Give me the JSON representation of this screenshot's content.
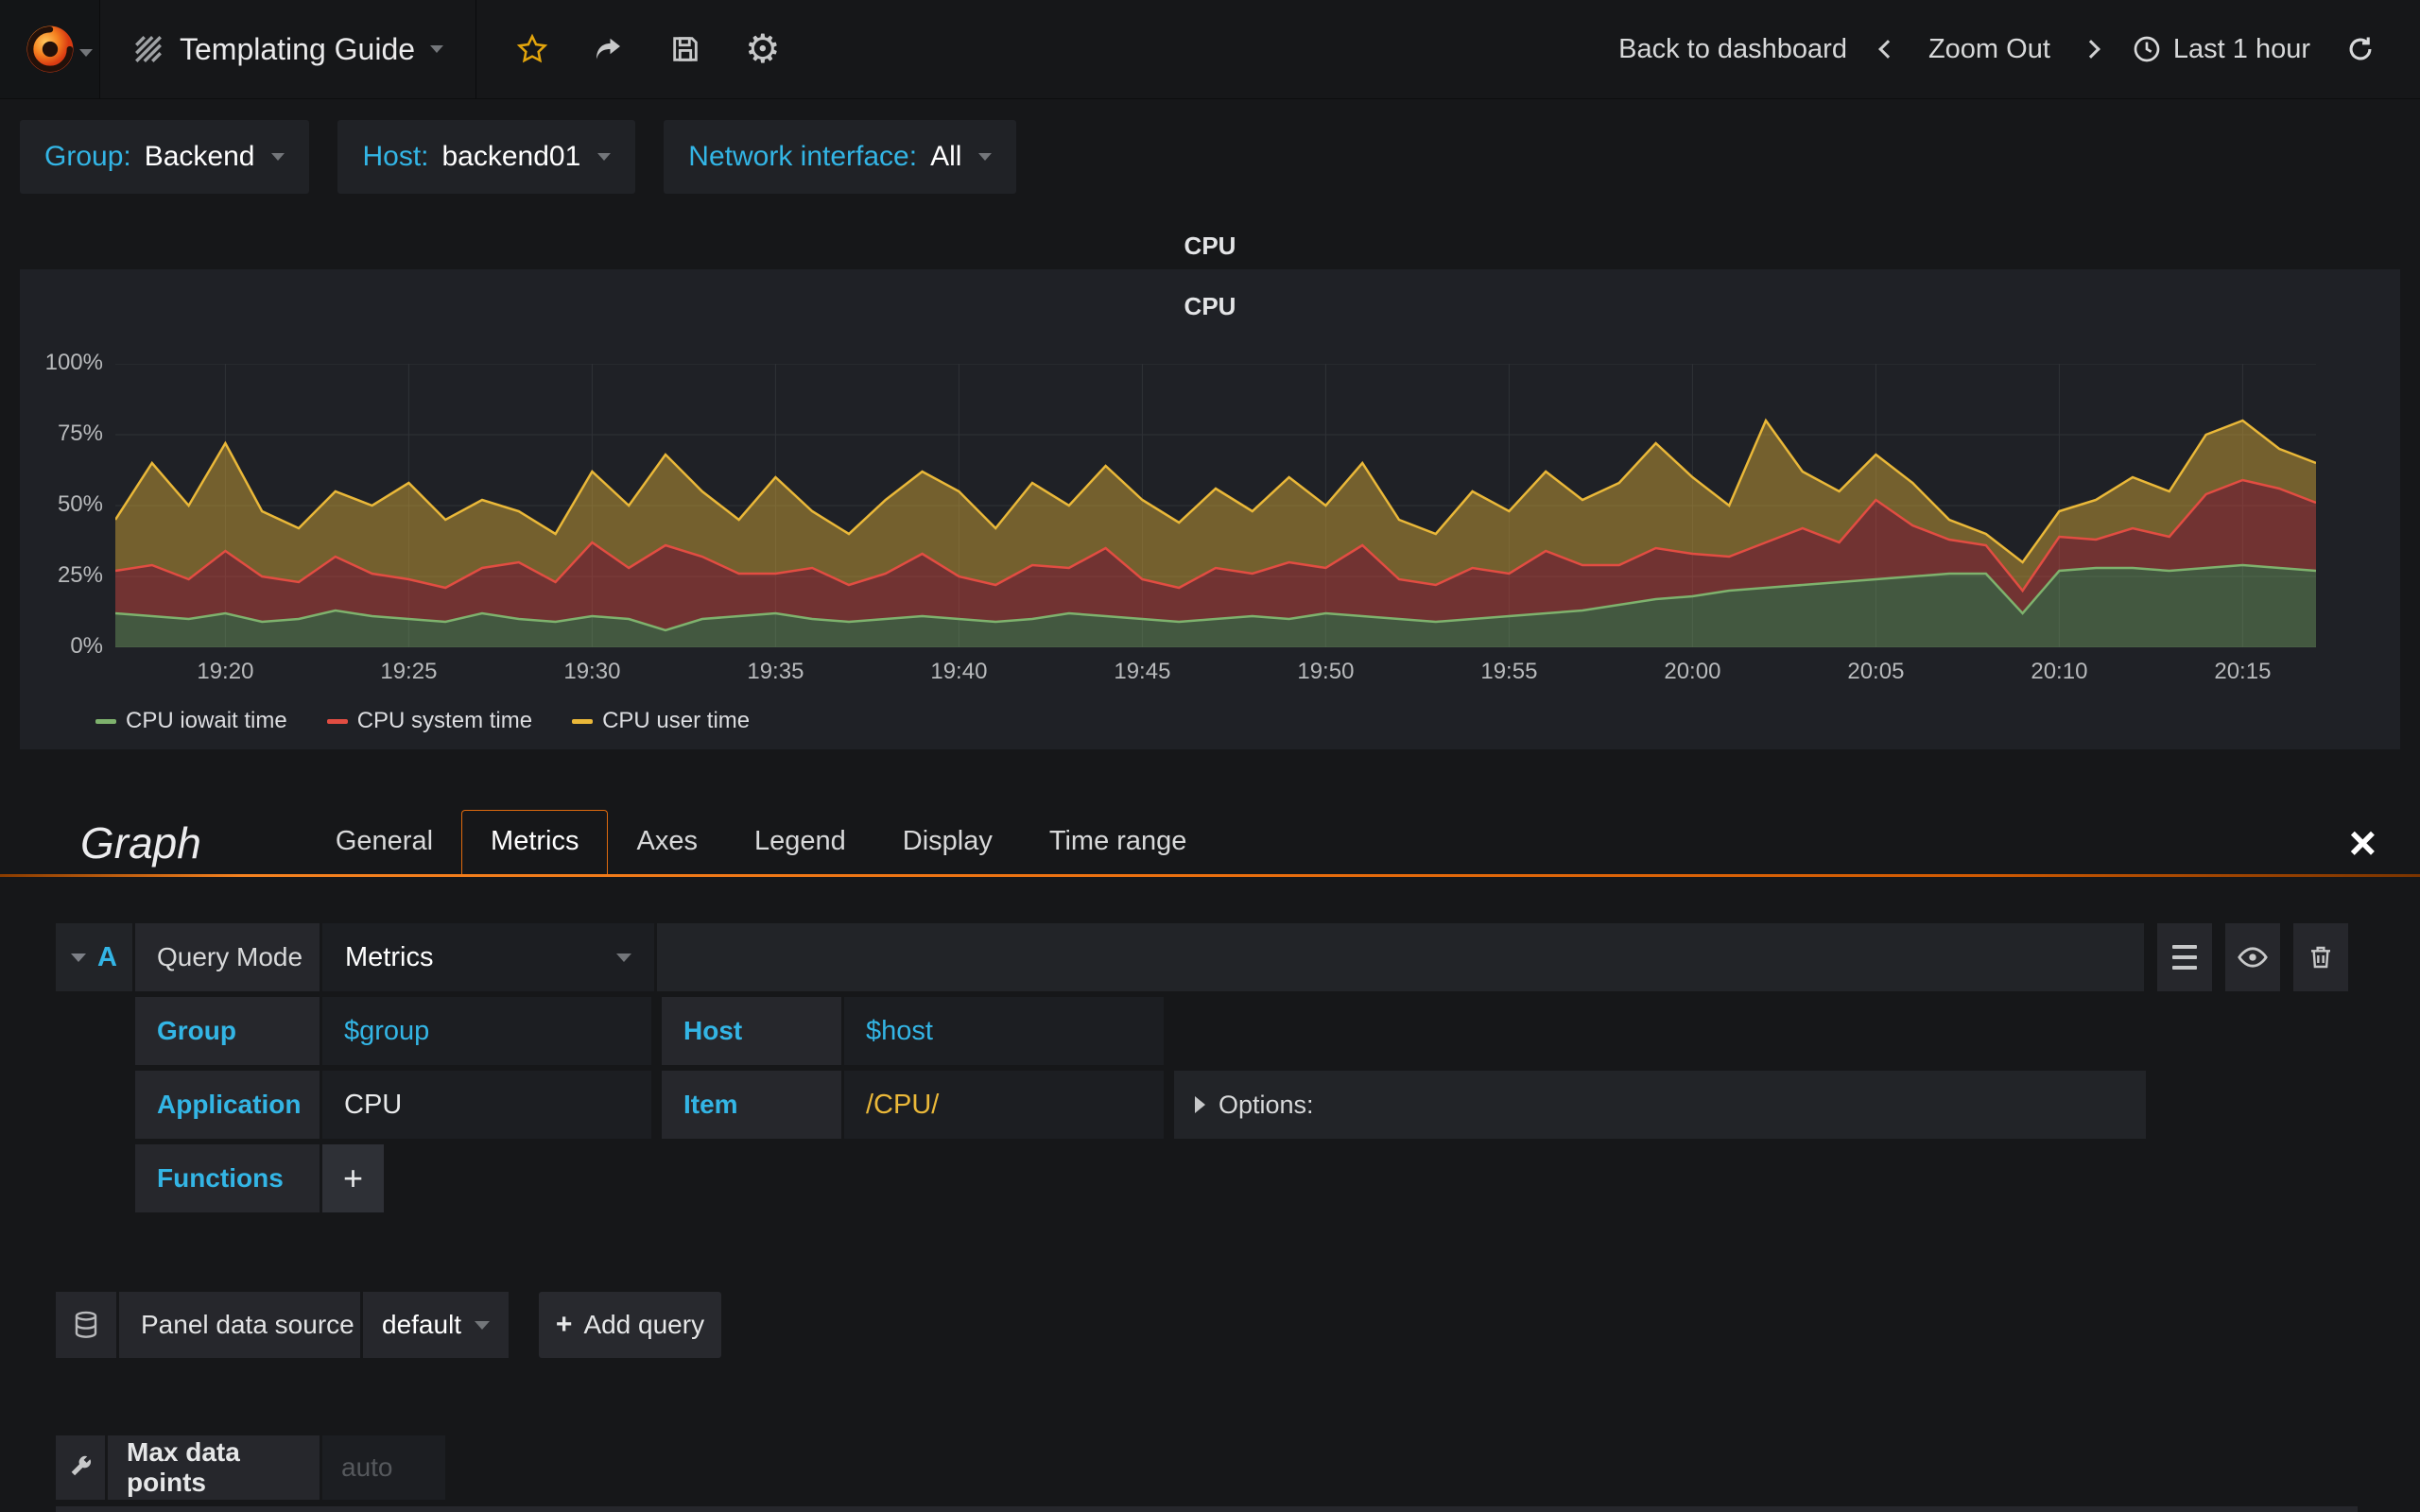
{
  "navbar": {
    "title": "Templating Guide",
    "back_to_dashboard": "Back to dashboard",
    "zoom_out": "Zoom Out",
    "time_range": "Last 1 hour"
  },
  "variables": [
    {
      "label": "Group:",
      "value": "Backend"
    },
    {
      "label": "Host:",
      "value": "backend01"
    },
    {
      "label": "Network interface:",
      "value": "All"
    }
  ],
  "panel": {
    "title": "CPU"
  },
  "chart_data": {
    "type": "area",
    "stacked": true,
    "title": "CPU",
    "ylim": [
      0,
      100
    ],
    "y_ticks": [
      "0%",
      "25%",
      "50%",
      "75%",
      "100%"
    ],
    "x_start": "19:17",
    "x_end": "20:17",
    "x_interval_minutes": 1,
    "x_tick_labels": [
      "19:20",
      "19:25",
      "19:30",
      "19:35",
      "19:40",
      "19:45",
      "19:50",
      "19:55",
      "20:00",
      "20:05",
      "20:10",
      "20:15"
    ],
    "x_first_tick_index": 3,
    "x_tick_step": 5,
    "grid": true,
    "legend_position": "bottom",
    "unit": "percent",
    "series": [
      {
        "name": "CPU iowait time",
        "color": "#7EB26D",
        "values": [
          12,
          11,
          10,
          12,
          9,
          10,
          13,
          11,
          10,
          9,
          12,
          10,
          9,
          11,
          10,
          6,
          10,
          11,
          12,
          10,
          9,
          10,
          11,
          10,
          9,
          10,
          12,
          11,
          10,
          9,
          10,
          11,
          10,
          12,
          11,
          10,
          9,
          10,
          11,
          12,
          13,
          15,
          17,
          18,
          20,
          21,
          22,
          23,
          24,
          25,
          26,
          26,
          12,
          27,
          28,
          28,
          27,
          28,
          29,
          28,
          27
        ]
      },
      {
        "name": "CPU system time",
        "color": "#E24D42",
        "values": [
          15,
          18,
          14,
          22,
          16,
          13,
          19,
          15,
          14,
          12,
          16,
          20,
          14,
          26,
          18,
          30,
          22,
          15,
          14,
          18,
          13,
          16,
          22,
          15,
          13,
          19,
          16,
          24,
          14,
          12,
          18,
          15,
          20,
          16,
          25,
          14,
          13,
          18,
          15,
          22,
          16,
          14,
          18,
          15,
          12,
          16,
          20,
          14,
          28,
          18,
          12,
          10,
          8,
          12,
          10,
          14,
          12,
          26,
          30,
          28,
          24
        ]
      },
      {
        "name": "CPU user time",
        "color": "#EAB839",
        "values": [
          18,
          36,
          26,
          38,
          23,
          19,
          23,
          24,
          34,
          24,
          24,
          18,
          17,
          25,
          22,
          32,
          23,
          19,
          34,
          20,
          18,
          26,
          29,
          30,
          20,
          29,
          22,
          29,
          28,
          23,
          28,
          22,
          30,
          22,
          29,
          21,
          18,
          27,
          22,
          28,
          23,
          29,
          37,
          27,
          18,
          43,
          20,
          18,
          16,
          15,
          7,
          4,
          10,
          9,
          14,
          18,
          16,
          21,
          21,
          14,
          14
        ]
      }
    ]
  },
  "editor": {
    "panel_type": "Graph",
    "tabs": [
      "General",
      "Metrics",
      "Axes",
      "Legend",
      "Display",
      "Time range"
    ],
    "active_tab": "Metrics",
    "query": {
      "letter": "A",
      "query_mode_label": "Query Mode",
      "query_mode_value": "Metrics",
      "group_label": "Group",
      "group_value": "$group",
      "host_label": "Host",
      "host_value": "$host",
      "application_label": "Application",
      "application_value": "CPU",
      "item_label": "Item",
      "item_value": "/CPU/",
      "options_label": "Options:",
      "functions_label": "Functions",
      "add_function_label": "+"
    },
    "datasource": {
      "label": "Panel data source",
      "value": "default",
      "add_query_label": "Add query"
    },
    "max_data_points": {
      "label": "Max data points",
      "placeholder": "auto"
    }
  }
}
